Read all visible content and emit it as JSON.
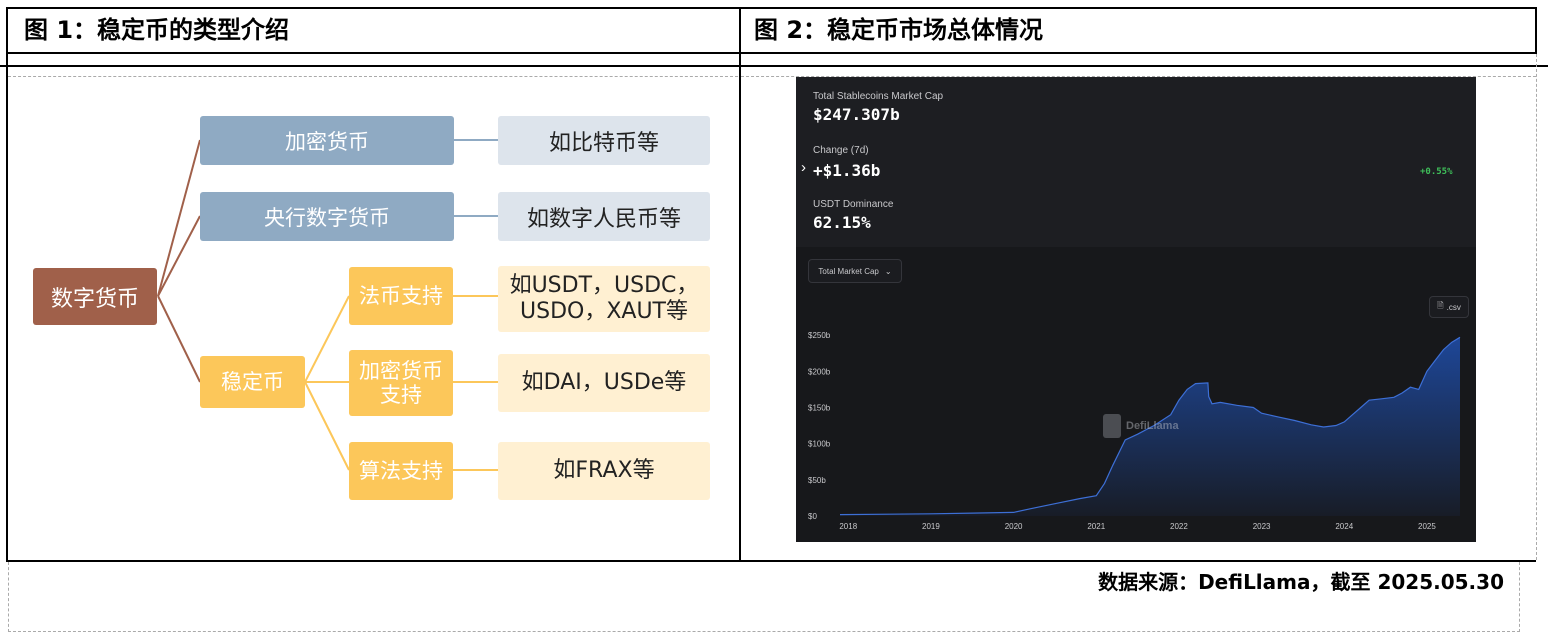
{
  "figures": {
    "fig1_title": "图 1：稳定币的类型介绍",
    "fig2_title": "图 2：稳定币市场总体情况"
  },
  "diagram": {
    "root": "数字货币",
    "crypto": "加密货币",
    "crypto_example": "如比特币等",
    "cbdc": "央行数字货币",
    "cbdc_example": "如数字人民币等",
    "stablecoin": "稳定币",
    "fiat_backed": "法币支持",
    "fiat_example": "如USDT，USDC，USDO，XAUT等",
    "crypto_backed": "加密货币支持",
    "crypto_backed_example": "如DAI，USDe等",
    "algorithmic": "算法支持",
    "algorithmic_example": "如FRAX等"
  },
  "stats": {
    "mcap_label": "Total Stablecoins Market Cap",
    "mcap_value": "$247.307b",
    "change_label": "Change (7d)",
    "change_value": "+$1.36b",
    "change_pct": "+0.55%",
    "dominance_label": "USDT Dominance",
    "dominance_value": "62.15%",
    "expand_arrow": "›"
  },
  "controls": {
    "dropdown_label": "Total Market Cap",
    "csv_label": ".csv"
  },
  "watermark": "DefiLlama",
  "colors": {
    "accent_green": "#3fbf5a",
    "area_fill": "#1f4fae"
  },
  "chart_data": {
    "type": "area",
    "title": "",
    "xlabel": "",
    "ylabel": "",
    "ylim": [
      0,
      275
    ],
    "y_ticks": [
      "$0",
      "$50b",
      "$100b",
      "$150b",
      "$200b",
      "$250b"
    ],
    "y_tick_values": [
      0,
      50,
      100,
      150,
      200,
      250
    ],
    "x_ticks": [
      "2018",
      "2019",
      "2020",
      "2021",
      "2022",
      "2023",
      "2024",
      "2025"
    ],
    "x_tick_values": [
      2018,
      2019,
      2020,
      2021,
      2022,
      2023,
      2024,
      2025
    ],
    "xlim": [
      2017.9,
      2025.4
    ],
    "series": [
      {
        "x": [
          2017.9,
          2018.5,
          2019.0,
          2019.5,
          2020.0,
          2020.2,
          2020.5,
          2020.8,
          2021.0,
          2021.1,
          2021.2,
          2021.35,
          2021.5,
          2021.7,
          2021.9,
          2022.0,
          2022.1,
          2022.2,
          2022.35,
          2022.36,
          2022.4,
          2022.5,
          2022.7,
          2022.9,
          2023.0,
          2023.2,
          2023.4,
          2023.6,
          2023.75,
          2023.9,
          2024.0,
          2024.1,
          2024.2,
          2024.3,
          2024.45,
          2024.6,
          2024.7,
          2024.8,
          2024.9,
          2025.0,
          2025.1,
          2025.2,
          2025.3,
          2025.4
        ],
        "y": [
          2,
          2.5,
          3,
          4,
          5,
          10,
          17,
          24,
          28,
          45,
          70,
          105,
          113,
          125,
          140,
          160,
          175,
          183,
          184,
          165,
          155,
          157,
          153,
          150,
          142,
          137,
          132,
          126,
          123,
          125,
          130,
          140,
          150,
          160,
          162,
          164,
          170,
          178,
          175,
          200,
          215,
          230,
          240,
          247
        ]
      }
    ]
  }
}
